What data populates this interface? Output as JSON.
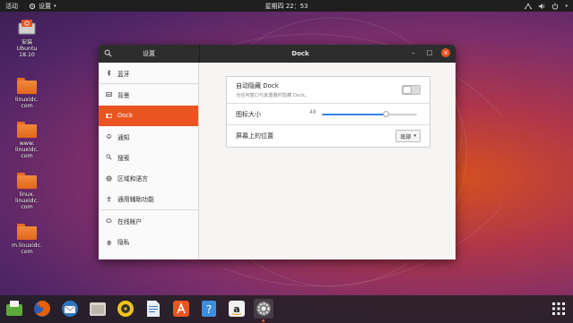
{
  "topbar": {
    "activities": "活动",
    "app_menu": "设置",
    "clock": "星期四 22：53"
  },
  "desktop": {
    "icons": [
      {
        "label": "安装\nUbuntu\n18.10",
        "icon": "ubuntu-installer-icon"
      },
      {
        "label": "linuxidc.\ncom",
        "icon": "folder-icon"
      },
      {
        "label": "www.\nlinuxidc.\ncom",
        "icon": "folder-icon"
      },
      {
        "label": "linux.\nlinuxidc.\ncom",
        "icon": "folder-icon"
      },
      {
        "label": "m.linuxidc.\ncom",
        "icon": "folder-icon"
      }
    ]
  },
  "window": {
    "left_title": "设置",
    "right_title": "Dock",
    "sidebar": [
      {
        "label": "蓝牙",
        "icon": "bluetooth-icon",
        "active": false
      },
      {
        "label": "背景",
        "icon": "background-icon",
        "active": false
      },
      {
        "label": "Dock",
        "icon": "dock-icon",
        "active": true
      },
      {
        "label": "通知",
        "icon": "bell-icon",
        "active": false
      },
      {
        "label": "搜索",
        "icon": "search-icon",
        "active": false
      },
      {
        "label": "区域和语言",
        "icon": "globe-icon",
        "active": false
      },
      {
        "label": "通用辅助功能",
        "icon": "accessibility-icon",
        "active": false
      },
      {
        "label": "在线帐户",
        "icon": "cloud-icon",
        "active": false
      },
      {
        "label": "隐私",
        "icon": "hand-icon",
        "active": false
      }
    ],
    "dock_settings": {
      "autohide_title": "自动隐藏 Dock",
      "autohide_subtitle": "当任何窗口与其重叠时隐藏 Dock。",
      "autohide_enabled": false,
      "icon_size_label": "图标大小",
      "icon_size_value": "48",
      "icon_size_fraction": 0.67,
      "position_label": "屏幕上的位置",
      "position_value": "底部"
    }
  },
  "dock": {
    "apps": [
      {
        "name": "ubuntu-software-icon",
        "color": "#5cab3a",
        "running": false
      },
      {
        "name": "firefox-icon",
        "color": "#e66000",
        "running": false
      },
      {
        "name": "thunderbird-icon",
        "color": "#2f74c0",
        "running": false
      },
      {
        "name": "files-icon",
        "color": "#d8d4cc",
        "running": false
      },
      {
        "name": "rhythmbox-icon",
        "color": "#f0c419",
        "running": false
      },
      {
        "name": "libreoffice-writer-icon",
        "color": "#e8eef7",
        "running": false
      },
      {
        "name": "software-center-icon",
        "color": "#e95420",
        "running": false
      },
      {
        "name": "help-icon",
        "color": "#3c8fe0",
        "running": false
      },
      {
        "name": "amazon-icon",
        "color": "#f2f2f2",
        "running": false
      },
      {
        "name": "settings-icon",
        "color": "#7b7b7b",
        "running": true
      }
    ],
    "show_apps_icon": "grid-icon"
  },
  "colors": {
    "accent": "#e95420",
    "topbar": "#1e1e1e",
    "titlebar": "#2d2d2d"
  }
}
